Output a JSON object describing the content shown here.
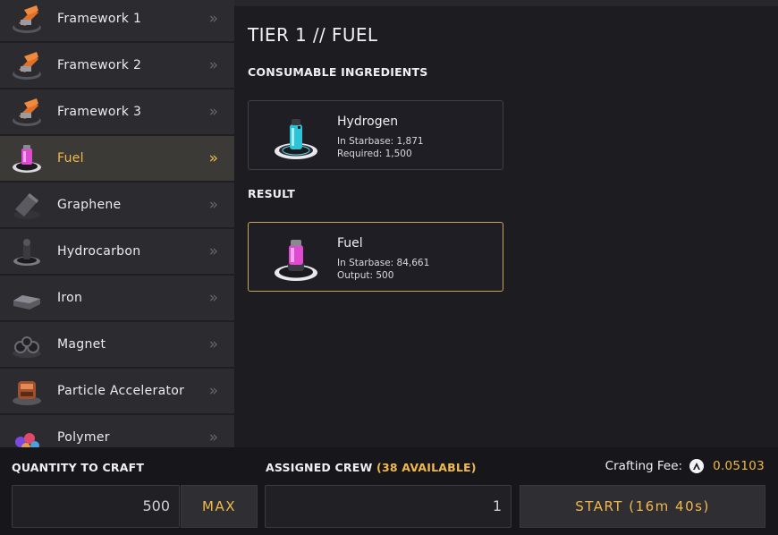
{
  "sidebar": {
    "items": [
      {
        "label": "Framework 1",
        "icon": "framework-icon",
        "active": false
      },
      {
        "label": "Framework 2",
        "icon": "framework-icon",
        "active": false
      },
      {
        "label": "Framework 3",
        "icon": "framework-icon",
        "active": false
      },
      {
        "label": "Fuel",
        "icon": "fuel-icon",
        "active": true
      },
      {
        "label": "Graphene",
        "icon": "graphene-icon",
        "active": false
      },
      {
        "label": "Hydrocarbon",
        "icon": "hydrocarbon-icon",
        "active": false
      },
      {
        "label": "Iron",
        "icon": "iron-icon",
        "active": false
      },
      {
        "label": "Magnet",
        "icon": "magnet-icon",
        "active": false
      },
      {
        "label": "Particle Accelerator",
        "icon": "particle-accelerator-icon",
        "active": false
      },
      {
        "label": "Polymer",
        "icon": "polymer-icon",
        "active": false
      }
    ],
    "chevron": "»"
  },
  "main": {
    "title": "TIER 1 // FUEL",
    "ingredients_heading": "CONSUMABLE INGREDIENTS",
    "ingredient": {
      "name": "Hydrogen",
      "starbase": "In Starbase: 1,871",
      "required": "Required: 1,500",
      "icon": "hydrogen-icon"
    },
    "result_heading": "RESULT",
    "result": {
      "name": "Fuel",
      "starbase": "In Starbase: 84,661",
      "output": "Output: 500",
      "icon": "fuel-icon"
    }
  },
  "footer": {
    "quantity_label": "QUANTITY TO CRAFT",
    "quantity_value": "500",
    "max_label": "MAX",
    "crew_label": "ASSIGNED CREW",
    "crew_available": "(38 AVAILABLE)",
    "crew_value": "1",
    "fee_label": "Crafting Fee:",
    "fee_value": "0.05103",
    "fee_icon": "atlas-token-icon",
    "start_label": "START (16m 40s)"
  },
  "colors": {
    "accent": "#f2b94a",
    "background": "#1b1b1f",
    "panel": "#2b2b30",
    "active_row": "#3b3a36"
  }
}
